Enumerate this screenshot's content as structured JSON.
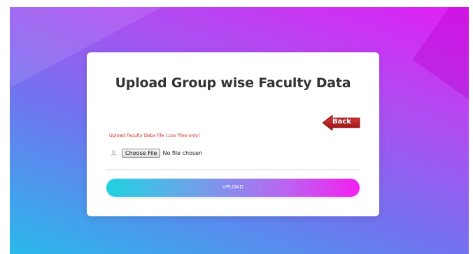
{
  "page": {
    "title": "Upload Group wise Faculty Data"
  },
  "back_button": {
    "label": "Back",
    "color": "#b5161b"
  },
  "file_upload": {
    "label": "Upload Faculty Data File (.csv files only)",
    "choose_button_label": "Choose File",
    "status_text": "No file chosen",
    "icon": "user-icon"
  },
  "submit": {
    "label": "UPLOAD"
  },
  "colors": {
    "label_red": "#d41e1e",
    "gradient_start": "#1fd2e0",
    "gradient_end": "#f51ef1"
  }
}
